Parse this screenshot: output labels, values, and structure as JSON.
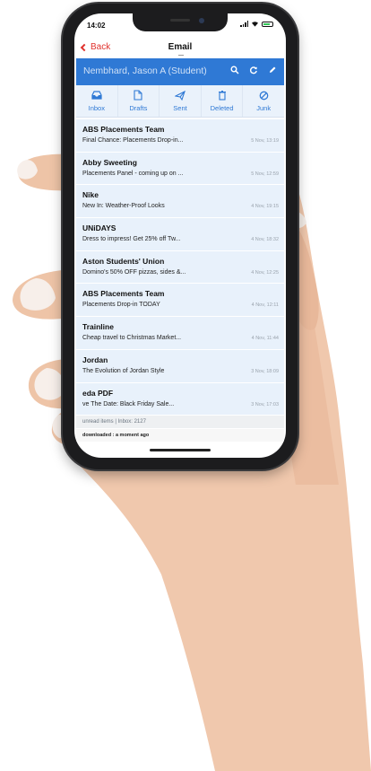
{
  "status_bar": {
    "time": "14:02"
  },
  "nav": {
    "back_label": "Back",
    "title": "Email"
  },
  "account": {
    "name": "Nembhard, Jason A (Student)",
    "icons": [
      "search-icon",
      "refresh-icon",
      "compose-icon"
    ]
  },
  "folders": [
    {
      "label": "Inbox",
      "icon": "inbox-icon"
    },
    {
      "label": "Drafts",
      "icon": "drafts-icon"
    },
    {
      "label": "Sent",
      "icon": "sent-icon"
    },
    {
      "label": "Deleted",
      "icon": "trash-icon"
    },
    {
      "label": "Junk",
      "icon": "junk-icon"
    }
  ],
  "messages": [
    {
      "from": "ABS Placements Team",
      "subject": "Final Chance: Placements Drop-in...",
      "date": "5 Nov, 13:19"
    },
    {
      "from": "Abby Sweeting",
      "subject": "Placements Panel - coming up on ...",
      "date": "5 Nov, 12:59"
    },
    {
      "from": "Nike",
      "subject": "New In: Weather-Proof Looks",
      "date": "4 Nov, 19:15"
    },
    {
      "from": "UNiDAYS",
      "subject": "Dress to impress! Get 25% off Tw...",
      "date": "4 Nov, 18:32"
    },
    {
      "from": "Aston Students' Union",
      "subject": "Domino's 50% OFF pizzas, sides &...",
      "date": "4 Nov, 12:25"
    },
    {
      "from": "ABS Placements Team",
      "subject": "Placements Drop-in TODAY",
      "date": "4 Nov, 12:11"
    },
    {
      "from": "Trainline",
      "subject": "Cheap travel to Christmas Market...",
      "date": "4 Nov, 11:44"
    },
    {
      "from": "Jordan",
      "subject": "The Evolution of Jordan Style",
      "date": "3 Nov, 18:09"
    },
    {
      "from": "eda PDF",
      "subject": "ve The Date: Black Friday Sale...",
      "date": "3 Nov, 17:03"
    }
  ],
  "footer": {
    "counts": "unread items | Inbox: 2127",
    "sync": "downloaded : a moment ago"
  },
  "colors": {
    "accent": "#2f79d5",
    "back": "#e0322d",
    "row_bg": "#e8f1fb",
    "battery": "#34c759"
  }
}
